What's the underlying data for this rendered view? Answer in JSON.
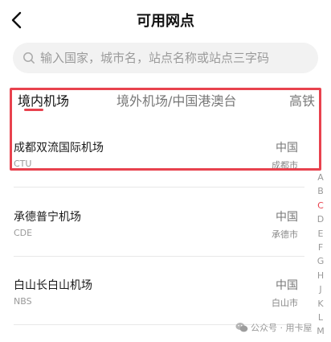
{
  "header": {
    "back_icon": "chevron-left-icon",
    "title": "可用网点"
  },
  "search": {
    "icon": "search-icon",
    "placeholder": "输入国家，城市名，站点名称或站点三字码"
  },
  "tabs": [
    {
      "label": "境内机场",
      "active": true
    },
    {
      "label": "境外机场/中国港澳台",
      "active": false
    },
    {
      "label": "高铁",
      "active": false
    }
  ],
  "stations": [
    {
      "name": "成都双流国际机场",
      "code": "CTU",
      "country": "中国",
      "city": "成都市"
    },
    {
      "name": "承德普宁机场",
      "code": "CDE",
      "country": "中国",
      "city": "承德市"
    },
    {
      "name": "白山长白山机场",
      "code": "NBS",
      "country": "中国",
      "city": "白山市"
    }
  ],
  "index_letters": [
    "A",
    "B",
    "C",
    "D",
    "E",
    "F",
    "G",
    "H",
    "J",
    "K",
    "L",
    "M"
  ],
  "index_active": "C",
  "watermark": {
    "icon": "wechat-icon",
    "text": "公众号 · 用卡屋"
  },
  "colors": {
    "accent": "#e8424e",
    "highlight_box": "#e8424e"
  }
}
